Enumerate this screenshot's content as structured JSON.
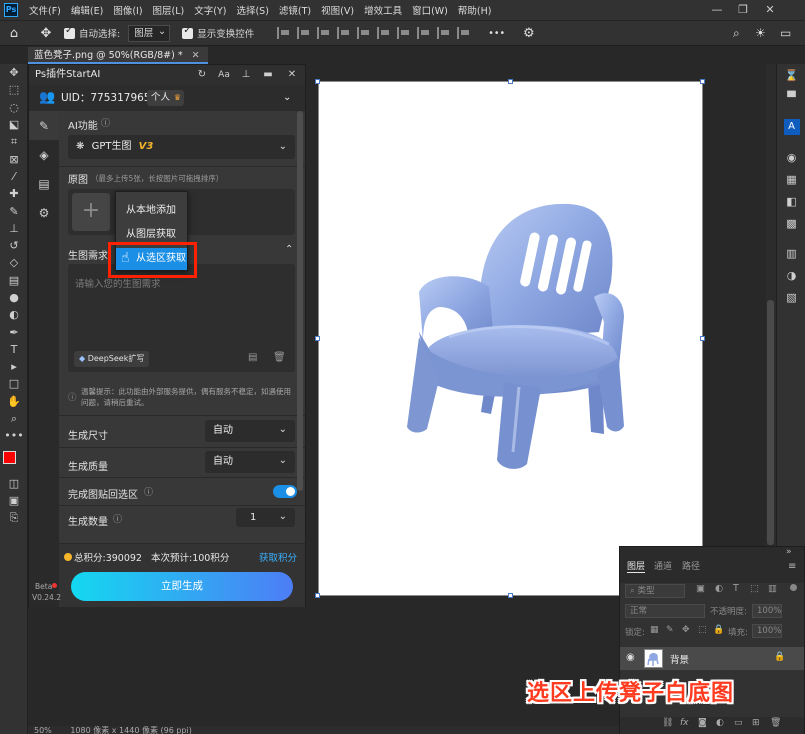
{
  "menubar": {
    "logo": "Ps",
    "items": [
      "文件(F)",
      "编辑(E)",
      "图像(I)",
      "图层(L)",
      "文字(Y)",
      "选择(S)",
      "滤镜(T)",
      "视图(V)",
      "增效工具",
      "窗口(W)",
      "帮助(H)"
    ],
    "min_glyph": "—",
    "max_glyph": "❐",
    "close_glyph": "✕"
  },
  "options": {
    "auto_select_label": "自动选择:",
    "auto_select_value": "图层",
    "show_transform_label": "显示变换控件",
    "more_glyph": "•••"
  },
  "document": {
    "tab_title": "蓝色凳子.png @ 50%(RGB/8#) *",
    "tab_close": "✕"
  },
  "plugin": {
    "title": "Ps插件StartAI",
    "uid_label": "UID：775317965",
    "account_badge": "个人",
    "ai_function_label": "AI功能",
    "model_name": "GPT生图",
    "model_version": "V3",
    "original_label": "原图",
    "original_hint": "（最多上传5张，长按图片可拖拽排序）",
    "add_glyph": "+",
    "requirement_label": "生图需求",
    "requirement_placeholder": "请输入您的生图需求",
    "deepseek_label": "DeepSeek扩写",
    "notice": "温馨提示：此功能由外部服务提供，偶有服务不稳定，如遇使用问题，请稍后重试。",
    "size_label": "生成尺寸",
    "size_value": "自动",
    "quality_label": "生成质量",
    "quality_value": "自动",
    "paste_back_label": "完成图贴回选区",
    "count_label": "生成数量",
    "count_value": "1",
    "points_total": "总积分:390092",
    "points_estimate": "本次预计:100积分",
    "get_points": "获取积分",
    "generate_button": "立即生成",
    "version_line1": "Beta",
    "version_line2": "V0.24.2"
  },
  "context_menu": {
    "items": [
      "从本地添加",
      "从图层获取",
      "从选区获取"
    ]
  },
  "layers_panel": {
    "tabs": [
      "图层",
      "通道",
      "路径"
    ],
    "filter_label": "类型",
    "blend_mode": "正常",
    "opacity_label": "不透明度:",
    "opacity_value": "100%",
    "lock_label": "锁定:",
    "fill_label": "填充:",
    "fill_value": "100%",
    "layer_name": "背景"
  },
  "status_bar": {
    "zoom": "50%",
    "size": "1080 像素 x 1440 像素 (96 ppi)"
  },
  "caption": "选区上传凳子白底图",
  "colors": {
    "accent_blue": "#1b8fe6",
    "gradient_start": "#14d8f0",
    "gradient_end": "#4d7df5",
    "points_link": "#3ab0ff",
    "caption_red": "#ff3b1f",
    "foreground_swatch": "#ff0000",
    "chair_blue": "#8fa8e0"
  }
}
